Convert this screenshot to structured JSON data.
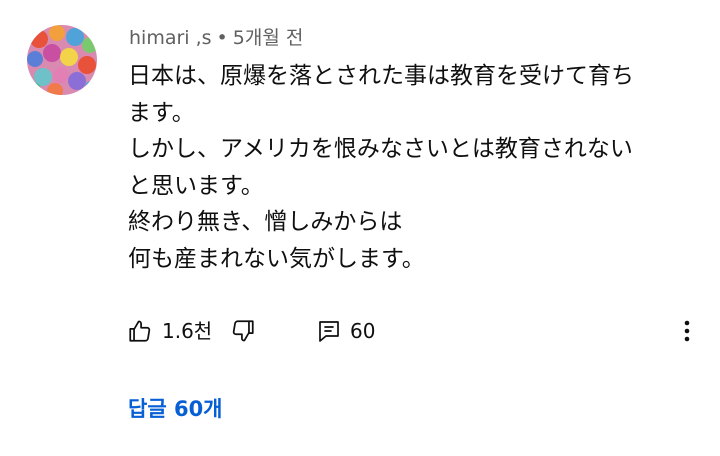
{
  "comment": {
    "author": "himari ,s",
    "separator": "•",
    "timestamp": "5개월 전",
    "body_lines": [
      "日本は、原爆を落とされた事は教育を受けて育ち",
      "ます。",
      "しかし、アメリカを恨みなさいとは教育されない",
      "と思います。",
      "終わり無き、憎しみからは",
      "何も産まれない気がします。"
    ],
    "actions": {
      "like_icon": "thumbs-up-icon",
      "like_count": "1.6천",
      "dislike_icon": "thumbs-down-icon",
      "reply_icon": "reply-icon",
      "reply_count": "60",
      "more_icon": "more-vertical-icon"
    },
    "replies_label": "답글 60개"
  },
  "colors": {
    "text": "#0f0f0f",
    "meta": "#606060",
    "link": "#065fd4"
  }
}
